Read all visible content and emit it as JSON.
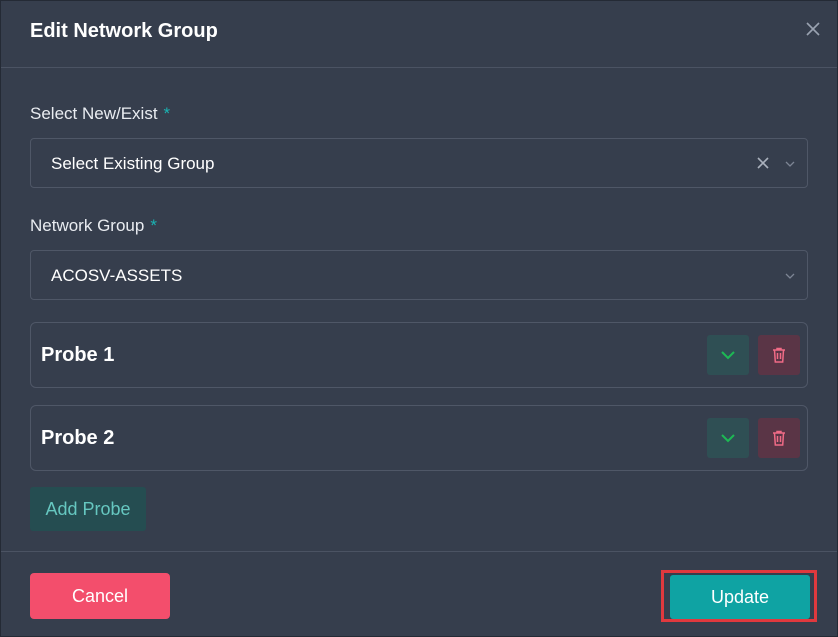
{
  "modal": {
    "title": "Edit Network Group",
    "close_icon": "close-icon"
  },
  "fields": {
    "select_new_exist": {
      "label": "Select New/Exist",
      "required_mark": "*",
      "value": "Select Existing Group"
    },
    "network_group": {
      "label": "Network Group",
      "required_mark": "*",
      "value": "ACOSV-ASSETS"
    }
  },
  "probes": [
    {
      "title": "Probe 1",
      "expand_icon": "chevron-down-icon",
      "delete_icon": "trash-icon"
    },
    {
      "title": "Probe 2",
      "expand_icon": "chevron-down-icon",
      "delete_icon": "trash-icon"
    }
  ],
  "add_probe_label": "Add Probe",
  "footer": {
    "cancel_label": "Cancel",
    "update_label": "Update"
  },
  "colors": {
    "background": "#363e4d",
    "accent_teal": "#0fa3a3",
    "danger": "#f34e6c",
    "highlight": "#e0393e"
  }
}
